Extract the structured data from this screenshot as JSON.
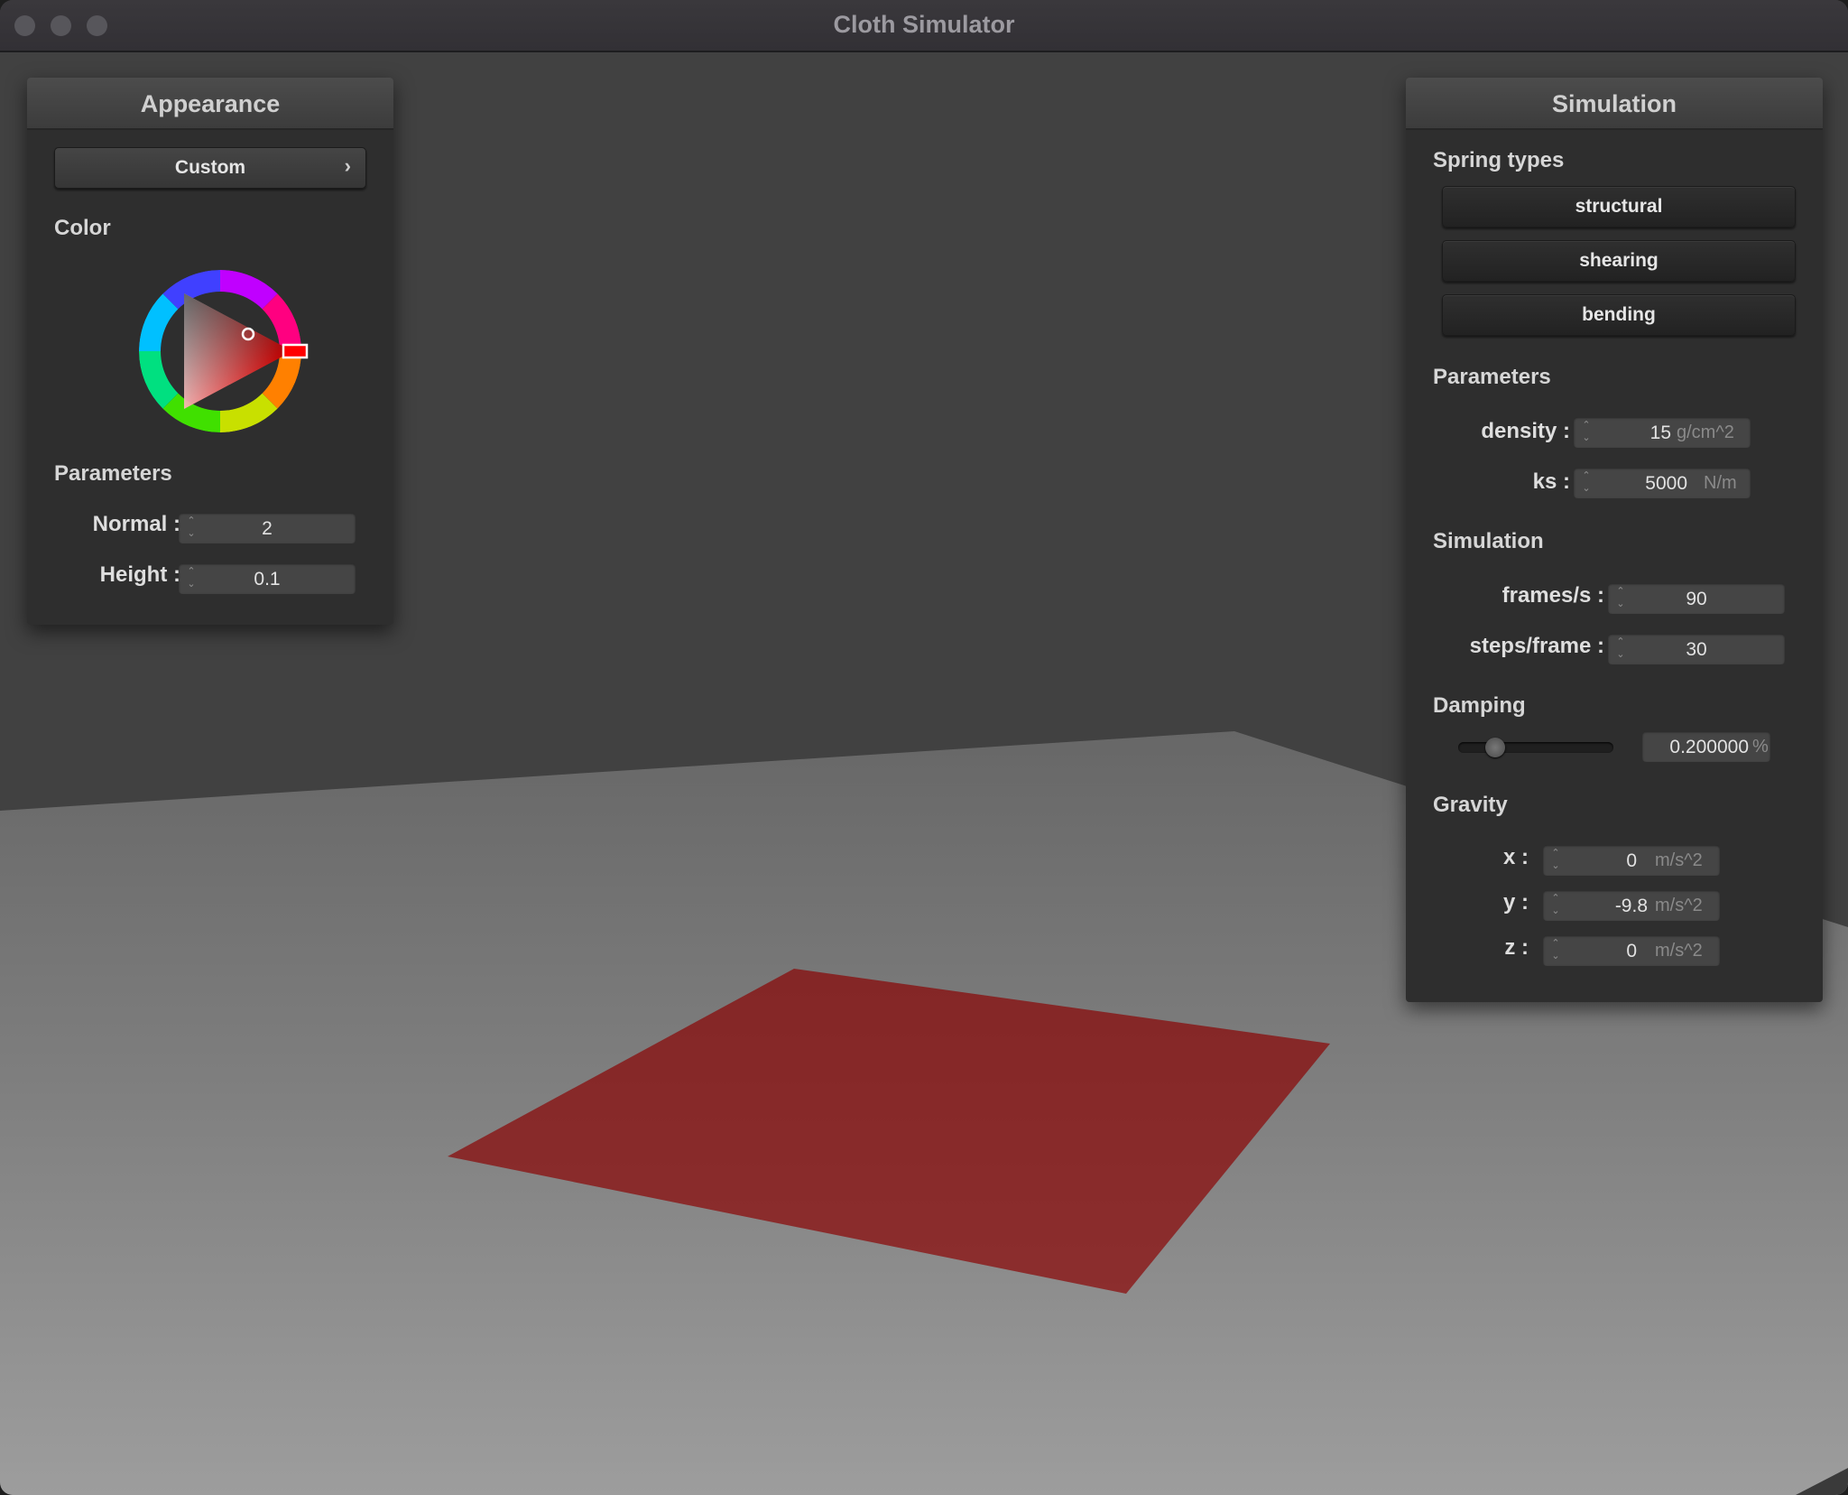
{
  "window": {
    "title": "Cloth Simulator"
  },
  "appearance": {
    "title": "Appearance",
    "preset": "Custom",
    "color_label": "Color",
    "cloth_color": "#8b0000",
    "parameters_label": "Parameters",
    "normal": {
      "label": "Normal :",
      "value": "2"
    },
    "height": {
      "label": "Height :",
      "value": "0.1"
    }
  },
  "simulation_panel": {
    "title": "Simulation",
    "spring_types_label": "Spring types",
    "spring_types": [
      "structural",
      "shearing",
      "bending"
    ],
    "parameters_label": "Parameters",
    "density": {
      "label": "density :",
      "value": "15",
      "unit": "g/cm^2"
    },
    "ks": {
      "label": "ks :",
      "value": "5000",
      "unit": "N/m"
    },
    "simulation_label": "Simulation",
    "frames": {
      "label": "frames/s :",
      "value": "90"
    },
    "steps": {
      "label": "steps/frame :",
      "value": "30"
    },
    "damping_label": "Damping",
    "damping": {
      "value": "0.200000",
      "unit": "%",
      "slider_fraction": 0.2
    },
    "gravity_label": "Gravity",
    "gravity": {
      "x": {
        "label": "x :",
        "value": "0",
        "unit": "m/s^2"
      },
      "y": {
        "label": "y :",
        "value": "-9.8",
        "unit": "m/s^2"
      },
      "z": {
        "label": "z :",
        "value": "0",
        "unit": "m/s^2"
      }
    }
  }
}
